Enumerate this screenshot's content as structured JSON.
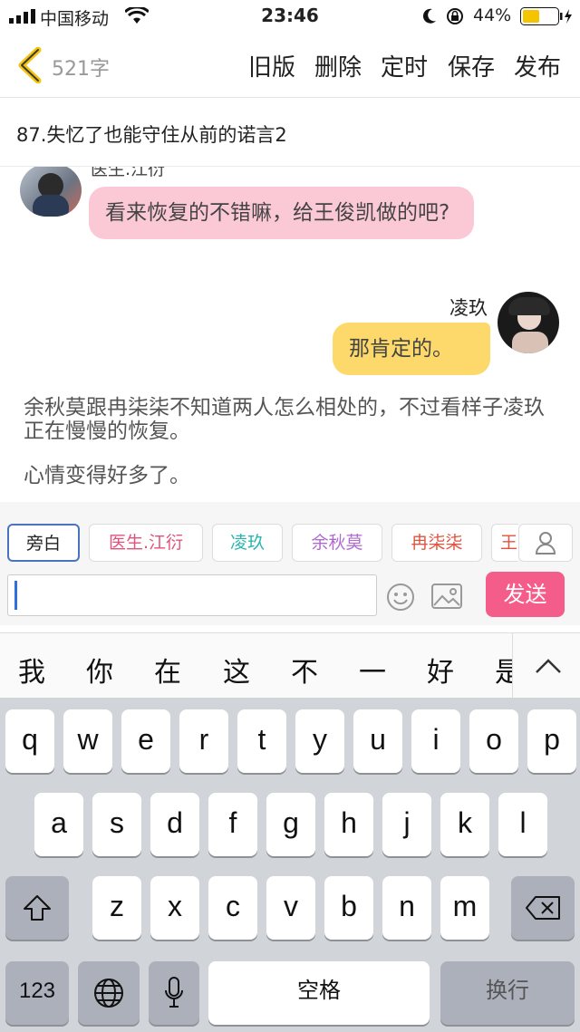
{
  "status_bar": {
    "carrier": "中国移动",
    "time": "23:46",
    "battery": "44%"
  },
  "header": {
    "word_count": "521字",
    "actions": [
      "旧版",
      "删除",
      "定时",
      "保存",
      "发布"
    ]
  },
  "chapter_title": "87.失忆了也能守住从前的诺言2",
  "chat": {
    "partial_name": "医生.江衍",
    "msg1": "看来恢复的不错嘛，给王俊凯做的吧?",
    "name2": "凌玖",
    "msg2": "那肯定的。",
    "narration1": "余秋莫跟冉柒柒不知道两人怎么相处的，不过看样子凌玖正在慢慢的恢复。",
    "narration2": "心情变得好多了。"
  },
  "roles": [
    {
      "label": "旁白",
      "color": "#222222"
    },
    {
      "label": "医生.江衍",
      "color": "#e0527d"
    },
    {
      "label": "凌玖",
      "color": "#2cb5b0"
    },
    {
      "label": "余秋莫",
      "color": "#b06ad0"
    },
    {
      "label": "冉柒柒",
      "color": "#e0533f"
    },
    {
      "label": "王",
      "color": "#e0533f"
    }
  ],
  "composer": {
    "send_label": "发送",
    "input_value": ""
  },
  "keyboard": {
    "candidates": [
      "我",
      "你",
      "在",
      "这",
      "不",
      "一",
      "好",
      "是"
    ],
    "row1": [
      "q",
      "w",
      "e",
      "r",
      "t",
      "y",
      "u",
      "i",
      "o",
      "p"
    ],
    "row2": [
      "a",
      "s",
      "d",
      "f",
      "g",
      "h",
      "j",
      "k",
      "l"
    ],
    "row3": [
      "z",
      "x",
      "c",
      "v",
      "b",
      "n",
      "m"
    ],
    "num_label": "123",
    "space_label": "空格",
    "return_label": "换行"
  }
}
